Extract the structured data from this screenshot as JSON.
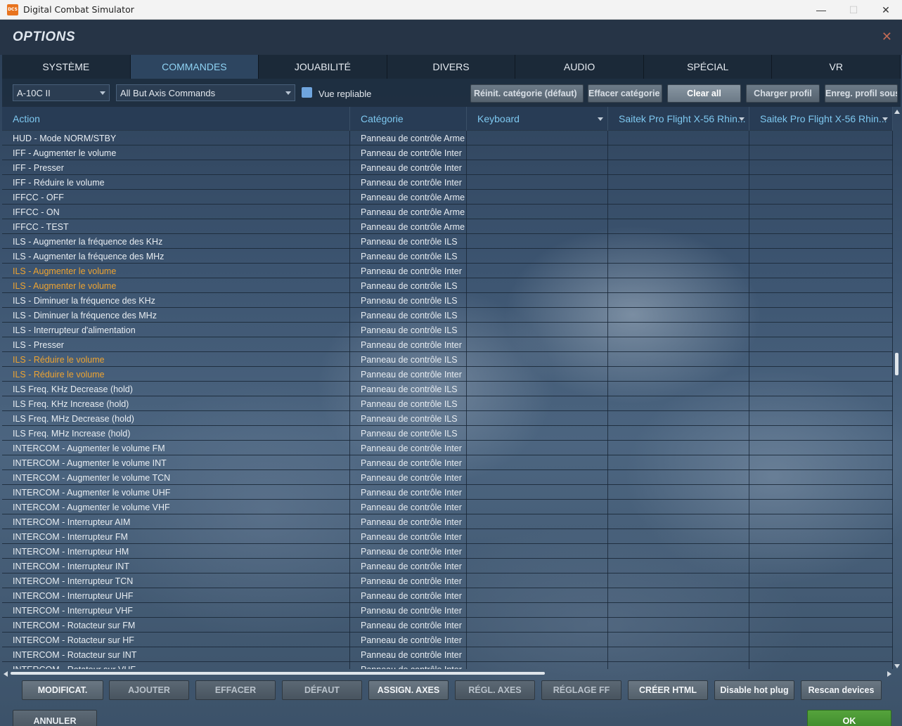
{
  "window": {
    "title": "Digital Combat Simulator",
    "app_icon_text": "DCS",
    "minimize": "—",
    "maximize": "☐",
    "close": "✕"
  },
  "header": {
    "title": "OPTIONS",
    "close": "✕"
  },
  "tabs": [
    {
      "label": "SYSTÈME",
      "active": false
    },
    {
      "label": "COMMANDES",
      "active": true
    },
    {
      "label": "JOUABILITÉ",
      "active": false
    },
    {
      "label": "DIVERS",
      "active": false
    },
    {
      "label": "AUDIO",
      "active": false
    },
    {
      "label": "SPÉCIAL",
      "active": false
    },
    {
      "label": "VR",
      "active": false
    }
  ],
  "toolbar": {
    "aircraft_select": "A-10C II",
    "filter_select": "All But Axis Commands",
    "collapsible_label": "Vue repliable",
    "collapsible_checked": true,
    "buttons": {
      "reset_category": "Réinit. catégorie (défaut)",
      "clear_category": "Effacer catégorie",
      "clear_all": "Clear all",
      "load_profile": "Charger profil",
      "save_profile": "Enreg. profil sous"
    }
  },
  "table": {
    "headers": {
      "action": "Action",
      "category": "Catégorie",
      "keyboard": "Keyboard",
      "device1": "Saitek Pro Flight X-56 Rhin...",
      "device2": "Saitek Pro Flight X-56 Rhin..."
    },
    "rows": [
      {
        "action": "HUD - Mode NORM/STBY",
        "category": "Panneau de contrôle Arme",
        "highlight": false
      },
      {
        "action": "IFF - Augmenter le volume",
        "category": "Panneau de contrôle Inter",
        "highlight": false
      },
      {
        "action": "IFF - Presser",
        "category": "Panneau de contrôle Inter",
        "highlight": false
      },
      {
        "action": "IFF - Réduire le volume",
        "category": "Panneau de contrôle Inter",
        "highlight": false
      },
      {
        "action": "IFFCC - OFF",
        "category": "Panneau de contrôle Arme",
        "highlight": false
      },
      {
        "action": "IFFCC - ON",
        "category": "Panneau de contrôle Arme",
        "highlight": false
      },
      {
        "action": "IFFCC - TEST",
        "category": "Panneau de contrôle Arme",
        "highlight": false
      },
      {
        "action": "ILS - Augmenter la fréquence des KHz",
        "category": "Panneau de contrôle ILS",
        "highlight": false
      },
      {
        "action": "ILS - Augmenter la fréquence des MHz",
        "category": "Panneau de contrôle ILS",
        "highlight": false
      },
      {
        "action": "ILS - Augmenter le volume",
        "category": "Panneau de contrôle Inter",
        "highlight": true
      },
      {
        "action": "ILS - Augmenter le volume",
        "category": "Panneau de contrôle ILS",
        "highlight": true
      },
      {
        "action": "ILS - Diminuer la fréquence des KHz",
        "category": "Panneau de contrôle ILS",
        "highlight": false
      },
      {
        "action": "ILS - Diminuer la fréquence des MHz",
        "category": "Panneau de contrôle ILS",
        "highlight": false
      },
      {
        "action": "ILS - Interrupteur d'alimentation",
        "category": "Panneau de contrôle ILS",
        "highlight": false
      },
      {
        "action": "ILS - Presser",
        "category": "Panneau de contrôle Inter",
        "highlight": false
      },
      {
        "action": "ILS - Réduire le volume",
        "category": "Panneau de contrôle ILS",
        "highlight": true
      },
      {
        "action": "ILS - Réduire le volume",
        "category": "Panneau de contrôle Inter",
        "highlight": true
      },
      {
        "action": "ILS Freq. KHz Decrease (hold)",
        "category": "Panneau de contrôle ILS",
        "highlight": false
      },
      {
        "action": "ILS Freq. KHz Increase (hold)",
        "category": "Panneau de contrôle ILS",
        "highlight": false
      },
      {
        "action": "ILS Freq. MHz Decrease (hold)",
        "category": "Panneau de contrôle ILS",
        "highlight": false
      },
      {
        "action": "ILS Freq. MHz Increase (hold)",
        "category": "Panneau de contrôle ILS",
        "highlight": false
      },
      {
        "action": "INTERCOM - Augmenter le volume FM",
        "category": "Panneau de contrôle Inter",
        "highlight": false
      },
      {
        "action": "INTERCOM - Augmenter le volume INT",
        "category": "Panneau de contrôle Inter",
        "highlight": false
      },
      {
        "action": "INTERCOM - Augmenter le volume TCN",
        "category": "Panneau de contrôle Inter",
        "highlight": false
      },
      {
        "action": "INTERCOM - Augmenter le volume UHF",
        "category": "Panneau de contrôle Inter",
        "highlight": false
      },
      {
        "action": "INTERCOM - Augmenter le volume VHF",
        "category": "Panneau de contrôle Inter",
        "highlight": false
      },
      {
        "action": "INTERCOM - Interrupteur AIM",
        "category": "Panneau de contrôle Inter",
        "highlight": false
      },
      {
        "action": "INTERCOM - Interrupteur FM",
        "category": "Panneau de contrôle Inter",
        "highlight": false
      },
      {
        "action": "INTERCOM - Interrupteur HM",
        "category": "Panneau de contrôle Inter",
        "highlight": false
      },
      {
        "action": "INTERCOM - Interrupteur INT",
        "category": "Panneau de contrôle Inter",
        "highlight": false
      },
      {
        "action": "INTERCOM - Interrupteur TCN",
        "category": "Panneau de contrôle Inter",
        "highlight": false
      },
      {
        "action": "INTERCOM - Interrupteur UHF",
        "category": "Panneau de contrôle Inter",
        "highlight": false
      },
      {
        "action": "INTERCOM - Interrupteur VHF",
        "category": "Panneau de contrôle Inter",
        "highlight": false
      },
      {
        "action": "INTERCOM - Rotacteur sur FM",
        "category": "Panneau de contrôle Inter",
        "highlight": false
      },
      {
        "action": "INTERCOM - Rotacteur sur HF",
        "category": "Panneau de contrôle Inter",
        "highlight": false
      },
      {
        "action": "INTERCOM - Rotacteur sur INT",
        "category": "Panneau de contrôle Inter",
        "highlight": false
      },
      {
        "action": "INTERCOM - Rotateur sur VHF",
        "category": "Panneau de contrôle Inter",
        "highlight": false
      }
    ]
  },
  "bottom_buttons": [
    {
      "label": "MODIFICAT.",
      "enabled": true
    },
    {
      "label": "AJOUTER",
      "enabled": false
    },
    {
      "label": "EFFACER",
      "enabled": false
    },
    {
      "label": "DÉFAUT",
      "enabled": false
    },
    {
      "label": "ASSIGN. AXES",
      "enabled": true
    },
    {
      "label": "RÉGL. AXES",
      "enabled": false
    },
    {
      "label": "RÉGLAGE FF",
      "enabled": false
    },
    {
      "label": "CRÉER HTML",
      "enabled": true
    },
    {
      "label": "Disable hot plug",
      "enabled": true
    },
    {
      "label": "Rescan devices",
      "enabled": true
    }
  ],
  "footer": {
    "cancel": "ANNULER",
    "ok": "OK"
  }
}
